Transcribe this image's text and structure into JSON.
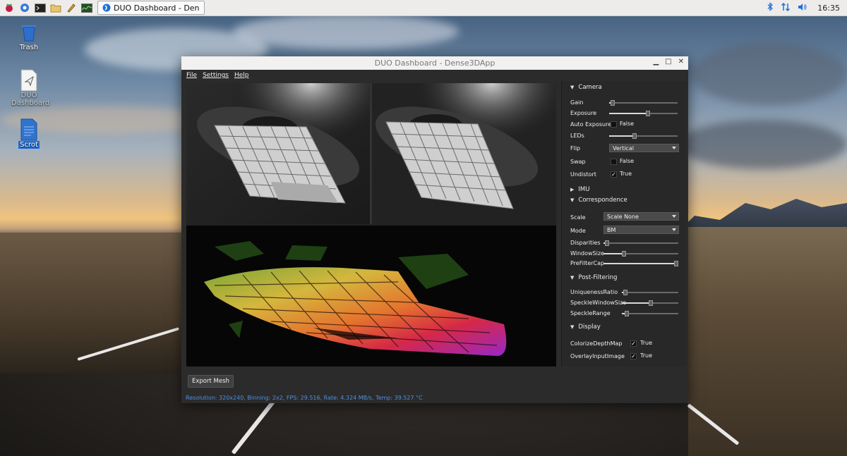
{
  "taskbar": {
    "window_task": "DUO Dashboard - Den",
    "clock": "16:35"
  },
  "desktop_icons": {
    "trash": "Trash",
    "duo": "DUO Dashboard",
    "scrot": "Scrot"
  },
  "window": {
    "title": "DUO Dashboard - Dense3DApp",
    "menu": {
      "file": "File",
      "settings": "Settings",
      "help": "Help"
    },
    "export_button": "Export Mesh",
    "status": "Resolution: 320x240, Binning: 2x2, FPS: 29.516, Rate: 4.324 MB/s, Temp: 39.527 °C"
  },
  "panel": {
    "camera": {
      "header": "Camera",
      "gain": {
        "label": "Gain",
        "value": 0.02
      },
      "exposure": {
        "label": "Exposure",
        "value": 0.57
      },
      "auto_exposure": {
        "label": "Auto Exposure",
        "checked": false,
        "text": "False"
      },
      "leds": {
        "label": "LEDs",
        "value": 0.36
      },
      "flip": {
        "label": "Flip",
        "value": "Vertical"
      },
      "swap": {
        "label": "Swap",
        "checked": false,
        "text": "False"
      },
      "undistort": {
        "label": "Undistort",
        "checked": true,
        "text": "True"
      }
    },
    "imu": {
      "header": "IMU"
    },
    "correspondence": {
      "header": "Correspondence",
      "scale": {
        "label": "Scale",
        "value": "Scale None"
      },
      "mode": {
        "label": "Mode",
        "value": "BM"
      },
      "disparities": {
        "label": "Disparities",
        "value": 0.02
      },
      "window_size": {
        "label": "WindowSize",
        "value": 0.26
      },
      "prefilter_cap": {
        "label": "PreFilterCap",
        "value": 1.0
      }
    },
    "post_filtering": {
      "header": "Post-Filtering",
      "uniqueness_ratio": {
        "label": "UniquenessRatio",
        "value": 0.03
      },
      "speckle_window_size": {
        "label": "SpeckleWindowSize",
        "value": 0.51
      },
      "speckle_range": {
        "label": "SpeckleRange",
        "value": 0.06
      }
    },
    "display": {
      "header": "Display",
      "colorize_depth_map": {
        "label": "ColorizeDepthMap",
        "checked": true,
        "text": "True"
      },
      "overlay_input_image": {
        "label": "OverlayInputImage",
        "checked": true,
        "text": "True"
      }
    }
  }
}
